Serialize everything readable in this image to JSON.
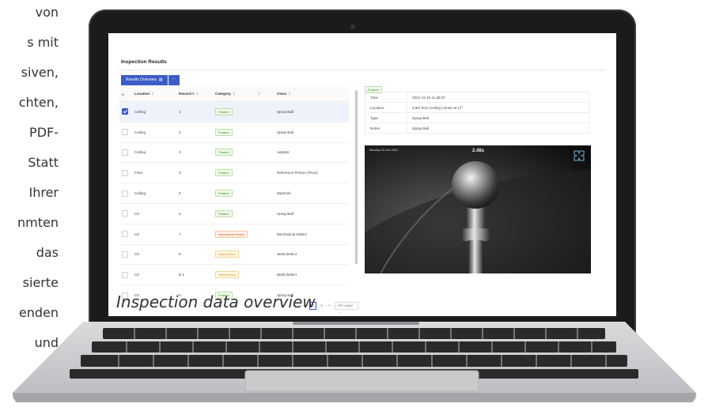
{
  "side_text": [
    "von",
    "s mit",
    "siven,",
    "chten,",
    "PDF-",
    "Statt",
    "Ihrer",
    "nmten",
    "das",
    "sierte",
    "enden",
    "und"
  ],
  "app": {
    "title": "Inspection Results"
  },
  "left_panel": {
    "tab_label": "Results Overview",
    "tab_more": "···",
    "columns": [
      "Location",
      "Record #",
      "Category",
      "Class"
    ],
    "rows": [
      {
        "location": "Ceiling",
        "record": "1",
        "category": "Feature",
        "category_type": "feature",
        "class": "Spray Ball",
        "checked": true
      },
      {
        "location": "Ceiling",
        "record": "2",
        "category": "Feature",
        "category_type": "feature",
        "class": "Spray Ball",
        "checked": false
      },
      {
        "location": "Ceiling",
        "record": "3",
        "category": "Feature",
        "category_type": "feature",
        "class": "Agitator",
        "checked": false
      },
      {
        "location": "Floor",
        "record": "4",
        "category": "Feature",
        "category_type": "feature",
        "class": "Reference Picture (Floor)",
        "checked": false
      },
      {
        "location": "Ceiling",
        "record": "5",
        "category": "Feature",
        "category_type": "feature",
        "class": "Manhole",
        "checked": false
      },
      {
        "location": "C0",
        "record": "6",
        "category": "Feature",
        "category_type": "feature",
        "class": "Spray Ball",
        "checked": false
      },
      {
        "location": "C0",
        "record": "7",
        "category": "Mechanical Defect",
        "category_type": "mech",
        "class": "Mechanical Defect",
        "checked": false
      },
      {
        "location": "C0",
        "record": "8",
        "category": "Weld Defect",
        "category_type": "weld",
        "class": "Weld Defect",
        "checked": false
      },
      {
        "location": "C0",
        "record": "8-1",
        "category": "Weld Defect",
        "category_type": "weld",
        "class": "Weld Defect",
        "checked": false
      },
      {
        "location": "C0",
        "record": "9",
        "category": "Feature",
        "category_type": "feature",
        "class": "Spray Ball",
        "checked": false
      }
    ],
    "pagination": {
      "prev": "<",
      "pages": [
        "1",
        "2"
      ],
      "current": "1",
      "next": ">",
      "page_size": "10 / page"
    }
  },
  "right_panel": {
    "badge": "Feature",
    "details": [
      {
        "key": "Time",
        "value": "2021-11-15 11:38:27"
      },
      {
        "key": "Location",
        "value": "0.9m from Ceiling Centre at 17°"
      },
      {
        "key": "Type",
        "value": "Spray Ball"
      },
      {
        "key": "Notes",
        "value": "Spray Ball"
      }
    ],
    "photo": {
      "timestamp": "Monday 15 Nov 2021",
      "counter": "2.48s",
      "logo": "INVERT ROBOTICS"
    }
  },
  "caption": "Inspection data overview",
  "colors": {
    "accent": "#3b5bc7",
    "feature": "#3f8f2f",
    "mechanical_defect": "#d4581e",
    "weld_defect": "#d98f1a"
  }
}
